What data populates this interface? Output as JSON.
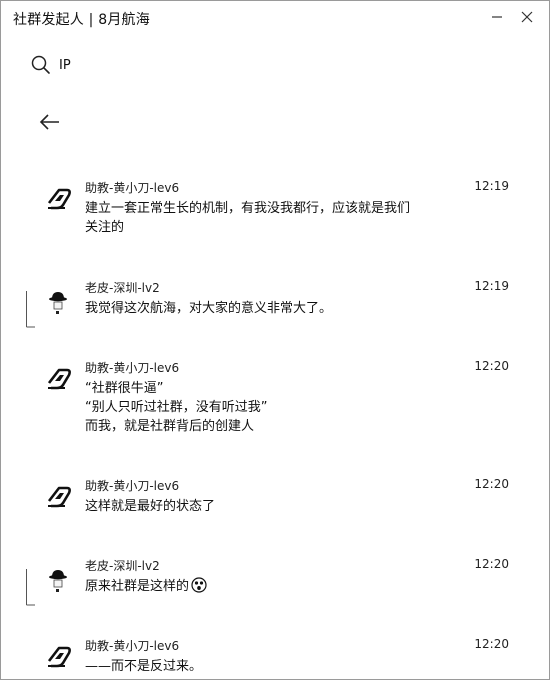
{
  "window": {
    "title": "社群发起人 | 8月航海"
  },
  "search": {
    "query": "IP"
  },
  "messages": [
    {
      "sender": "助教-黄小刀-lev6",
      "time": "12:19",
      "avatar": "logo-avatar",
      "lines": [
        "建立一套正常生长的机制，有我没我都行，应该就是我们",
        "关注的"
      ]
    },
    {
      "sender": "老皮-深圳-lv2",
      "time": "12:19",
      "avatar": "hat-avatar",
      "lines": [
        "我觉得这次航海，对大家的意义非常大了。"
      ]
    },
    {
      "sender": "助教-黄小刀-lev6",
      "time": "12:20",
      "avatar": "logo-avatar",
      "lines": [
        "“社群很牛逼”",
        "“别人只听过社群，没有听过我”",
        "而我，就是社群背后的创建人"
      ]
    },
    {
      "sender": "助教-黄小刀-lev6",
      "time": "12:20",
      "avatar": "logo-avatar",
      "lines": [
        "这样就是最好的状态了"
      ]
    },
    {
      "sender": "老皮-深圳-lv2",
      "time": "12:20",
      "avatar": "hat-avatar",
      "lines": [
        "原来社群是这样的"
      ],
      "emoji": "surprised-face-emoji"
    },
    {
      "sender": "助教-黄小刀-lev6",
      "time": "12:20",
      "avatar": "logo-avatar",
      "lines": [
        "——而不是反过来。"
      ]
    }
  ]
}
